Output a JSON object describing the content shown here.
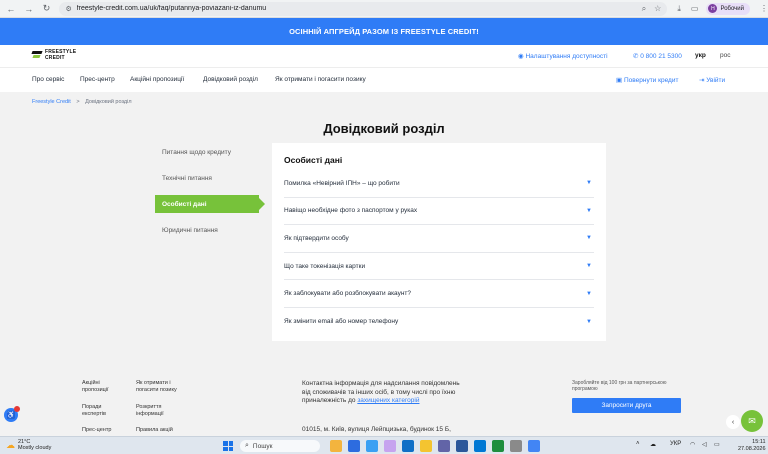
{
  "browser": {
    "url": "freestyle-credit.com.ua/uk/faq/putannya-poviazani-iz-danumu",
    "profile_label": "Робочий",
    "profile_initial": "Н"
  },
  "promo_banner": "ОСІННІЙ АПГРЕЙД РАЗОМ ІЗ FREESTYLE CREDIT!",
  "header": {
    "logo_line1": "FREESTYLE",
    "logo_line2": "CREDIT",
    "accessibility": "Налаштування доступності",
    "phone": "0 800 21 5300",
    "lang_active": "укр",
    "lang_other": "рос"
  },
  "nav": {
    "items": [
      "Про сервіс",
      "Прес-центр",
      "Акційні пропозиції",
      "Довідковий розділ",
      "Як отримати і погасити позику"
    ],
    "return_credit": "Повернути кредит",
    "login": "Увійти"
  },
  "breadcrumb": {
    "home": "Freestyle Credit",
    "separator": ">",
    "current": "Довідковий розділ"
  },
  "page_title": "Довідковий розділ",
  "side_menu": [
    "Питання щодо кредиту",
    "Технічні питання",
    "Особисті дані",
    "Юридичні питання"
  ],
  "side_menu_active_index": 2,
  "faq": {
    "title": "Особисті дані",
    "questions": [
      "Помилка «Невірний ІПН» – що робити",
      "Навіщо необхідне фото з паспортом у руках",
      "Як підтвердити особу",
      "Що таке токенізація картки",
      "Як заблокувати або розблокувати акаунт?",
      "Як змінити email або номер телефону"
    ]
  },
  "footer": {
    "links_col1": [
      "Акційні пропозиції",
      "Поради експертів",
      "Прес-центр"
    ],
    "links_col2": [
      "Як отримати і погасити позику",
      "Розкриття інформації",
      "Правила акцій"
    ],
    "contact_text": "Контактна інформація для надсилання повідомлень від споживачів та інших осіб, в тому числі про їхню приналежність до",
    "contact_link": "захищених категорій",
    "address": "01015, м. Київ, вулиця Лейпцизька, будинок 15 Б,",
    "promo_text": "Заробляйте від 100 грн за партнерською програмою",
    "invite_button": "Запросити друга"
  },
  "taskbar": {
    "temperature": "21°C",
    "weather": "Mostly cloudy",
    "search_placeholder": "Пошук",
    "language": "УКР",
    "time": "15:11",
    "date": "27.08.2026"
  },
  "colors": {
    "brand_blue": "#2f7cf6",
    "brand_green": "#77c23a"
  }
}
